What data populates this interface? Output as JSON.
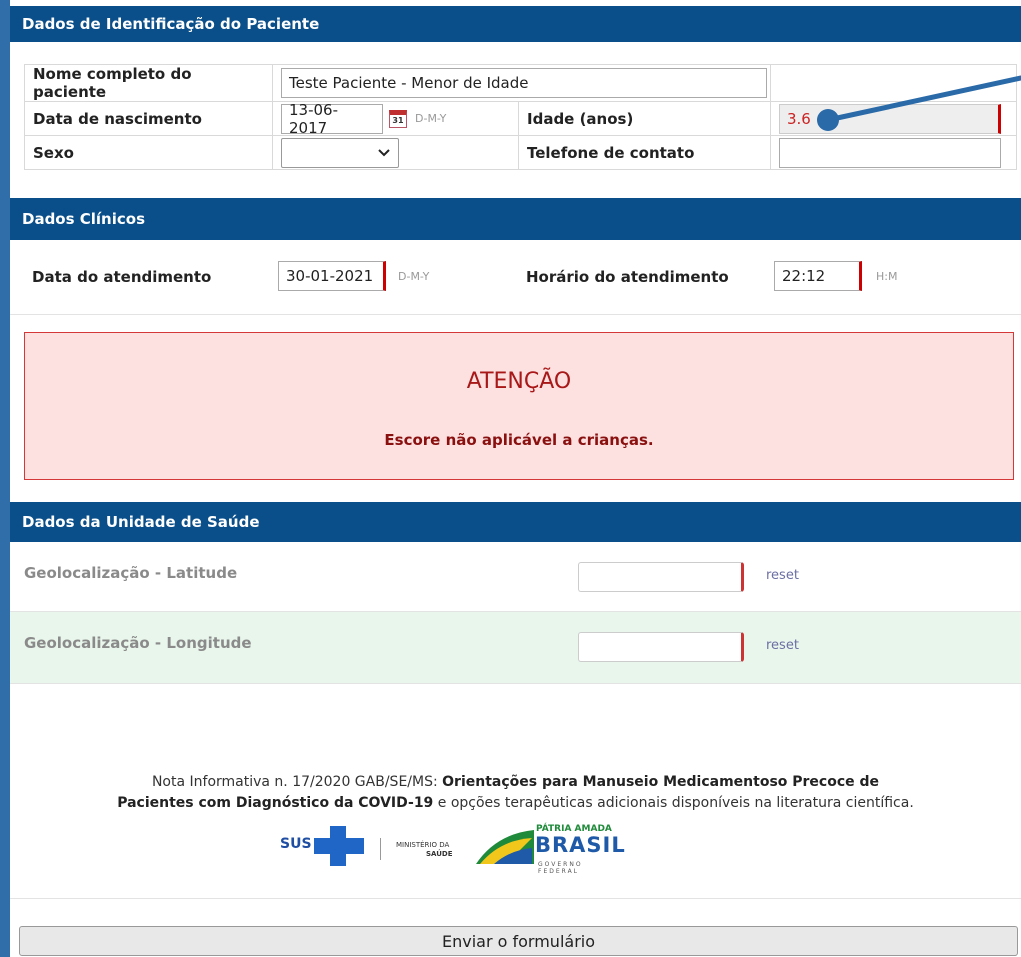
{
  "sections": {
    "identificacao": "Dados de Identificação do Paciente",
    "clinicos": "Dados Clínicos",
    "unidade": "Dados da Unidade de Saúde"
  },
  "paciente": {
    "nome_label": "Nome completo do paciente",
    "nome_value": "Teste Paciente - Menor de Idade",
    "nascimento_label": "Data de nascimento",
    "nascimento_value": "13-06-2017",
    "nascimento_cal": "31",
    "nascimento_fmt": "D-M-Y",
    "idade_label": "Idade (anos)",
    "idade_value": "3.6",
    "sexo_label": "Sexo",
    "sexo_value": "",
    "telefone_label": "Telefone de contato",
    "telefone_value": ""
  },
  "clinicos": {
    "data_label": "Data do atendimento",
    "data_value": "30-01-2021",
    "data_fmt": "D-M-Y",
    "hora_label": "Horário do atendimento",
    "hora_value": "22:12",
    "hora_fmt": "H:M"
  },
  "alerta": {
    "title": "ATENÇÃO",
    "message": "Escore não aplicável a crianças."
  },
  "unidade": {
    "latitude_label": "Geolocalização - Latitude",
    "longitude_label": "Geolocalização - Longitude",
    "reset_label": "reset"
  },
  "nota": {
    "prefix": "Nota Informativa n. 17/2020 GAB/SE/MS: ",
    "bold1": "Orientações para Manuseio Medicamentoso Precoce de",
    "bold2": "Pacientes com Diagnóstico da COVID-19",
    "suffix": " e opções terapêuticas adicionais disponíveis na literatura científica."
  },
  "logos": {
    "sus": "SUS",
    "ministerio_1": "MINISTÉRIO DA",
    "ministerio_2": "SAÚDE",
    "patria": "PÁTRIA AMADA",
    "brasil": "BRASIL",
    "governo": "GOVERNO FEDERAL"
  },
  "submit_label": "Enviar o formulário",
  "colors": {
    "header_bg": "#0a4f8a",
    "frame_border": "#2f6ea8",
    "alert_bg": "#fde0e0",
    "alert_border": "#d43838",
    "required_marker": "#cc0000",
    "annotation": "#2a6aa8"
  }
}
